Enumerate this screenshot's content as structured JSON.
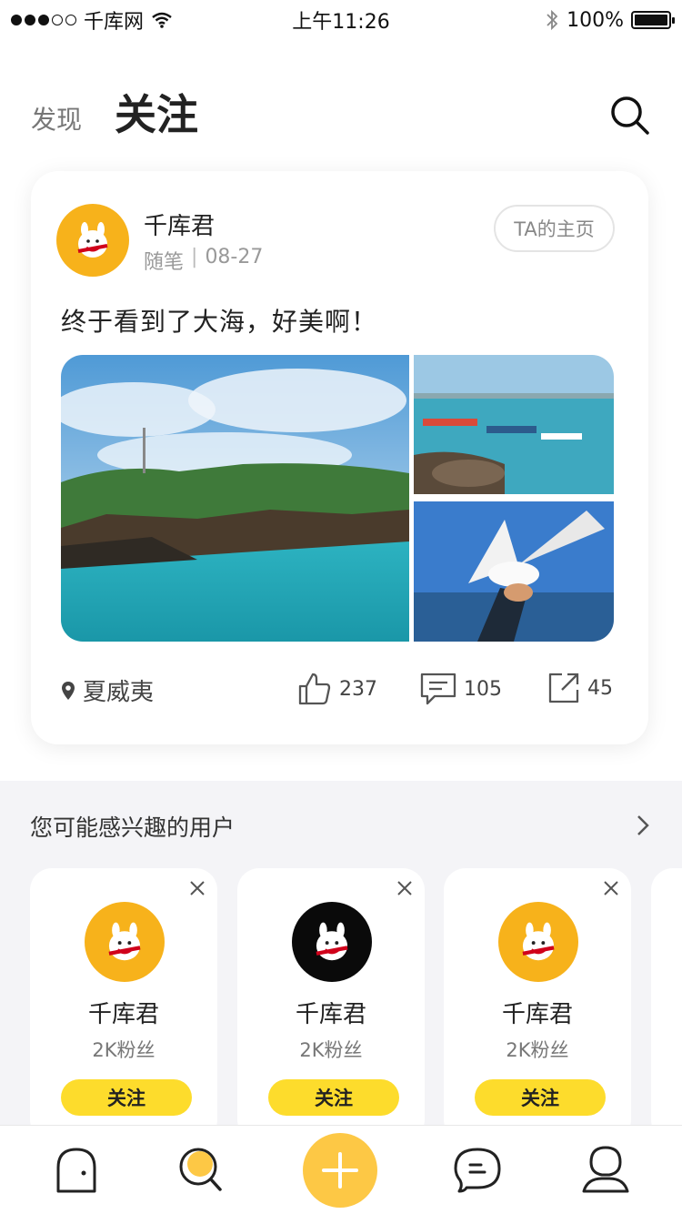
{
  "status_bar": {
    "carrier": "千库网",
    "time": "上午11:26",
    "battery": "100%"
  },
  "header": {
    "tab_discover": "发现",
    "tab_follow": "关注",
    "search_icon": "search-icon"
  },
  "post": {
    "author": "千库君",
    "category": "随笔",
    "separator": "|",
    "date": "08-27",
    "home_button": "TA的主页",
    "text": "终于看到了大海，好美啊！",
    "location": "夏威夷",
    "likes": "237",
    "comments": "105",
    "shares": "45"
  },
  "suggest": {
    "title": "您可能感兴趣的用户",
    "users": [
      {
        "name": "千库君",
        "fans": "2K粉丝",
        "follow": "关注"
      },
      {
        "name": "千库君",
        "fans": "2K粉丝",
        "follow": "关注"
      },
      {
        "name": "千库君",
        "fans": "2K粉丝",
        "follow": "关注"
      }
    ]
  },
  "colors": {
    "accent_yellow": "#fddc2c",
    "add_button": "#fdc845",
    "avatar_orange": "#f7b21b"
  }
}
